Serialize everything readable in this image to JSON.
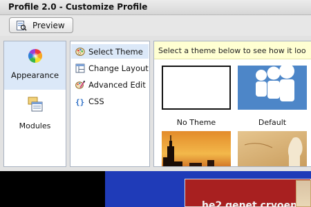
{
  "window": {
    "title": "Profile 2.0 - Customize Profile"
  },
  "toolbar": {
    "preview_label": "Preview",
    "preview_icon": "preview-icon"
  },
  "categories": [
    {
      "label": "Appearance",
      "icon": "color-wheel-icon",
      "selected": true
    },
    {
      "label": "Modules",
      "icon": "modules-icon",
      "selected": false
    }
  ],
  "subitems": [
    {
      "label": "Select Theme",
      "icon": "paint-icon",
      "selected": true
    },
    {
      "label": "Change Layout",
      "icon": "layout-grid-icon",
      "selected": false
    },
    {
      "label": "Advanced Edit",
      "icon": "advanced-edit-icon",
      "selected": false
    },
    {
      "label": "CSS",
      "icon": "css-braces-icon",
      "selected": false
    }
  ],
  "theme_panel": {
    "hint": "Select a theme below to see how it loo",
    "themes": [
      {
        "label": "No Theme",
        "selected": true
      },
      {
        "label": "Default",
        "selected": false
      },
      {
        "label": "",
        "selected": false
      },
      {
        "label": "",
        "selected": false
      }
    ]
  },
  "preview_banner": {
    "text": "he2 genet cryoen"
  },
  "colors": {
    "selection": "#dbe8f8",
    "hint_background": "#ffffd2",
    "default_theme_blue": "#4d86c8",
    "banner_blue": "#1f3bb8",
    "banner_red": "#a82020"
  }
}
